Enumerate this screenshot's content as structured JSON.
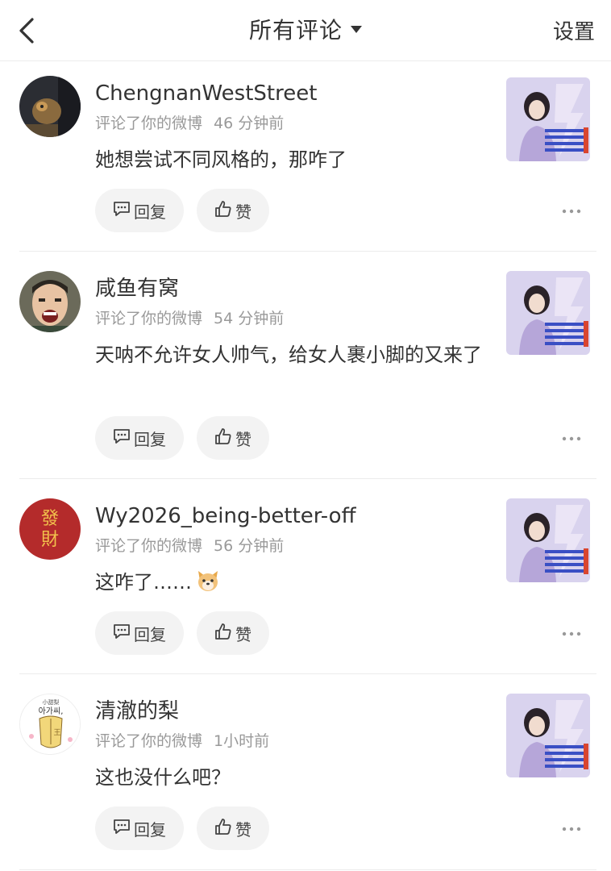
{
  "header": {
    "title": "所有评论",
    "settings_label": "设置"
  },
  "actions": {
    "reply_label": "回复",
    "like_label": "赞"
  },
  "comments": [
    {
      "username": "ChengnanWestStreet",
      "action": "评论了你的微博",
      "time": "46 分钟前",
      "content": "她想尝试不同风格的，那咋了"
    },
    {
      "username": "咸鱼有窝",
      "action": "评论了你的微博",
      "time": "54 分钟前",
      "content": "天呐不允许女人帅气，给女人裹小脚的又来了"
    },
    {
      "username": "Wy2026_being-better-off",
      "action": "评论了你的微博",
      "time": "56 分钟前",
      "content": "这咋了……",
      "emoji": "dog-face-emoji"
    },
    {
      "username": "清澈的梨",
      "action": "评论了你的微博",
      "time": "1小时前",
      "content": "这也没什么吧？"
    }
  ],
  "avatar_text": {
    "fa": "發",
    "cai": "財"
  },
  "avatar4_text": {
    "top": "小甜梨",
    "mid": "아가씨,",
    "mark": "王"
  },
  "colors": {
    "divider": "#ececec",
    "meta": "#999999",
    "pill_bg": "#f3f3f3",
    "text": "#333333",
    "red_avatar": "#b42b2b",
    "gold": "#f2c24c"
  }
}
